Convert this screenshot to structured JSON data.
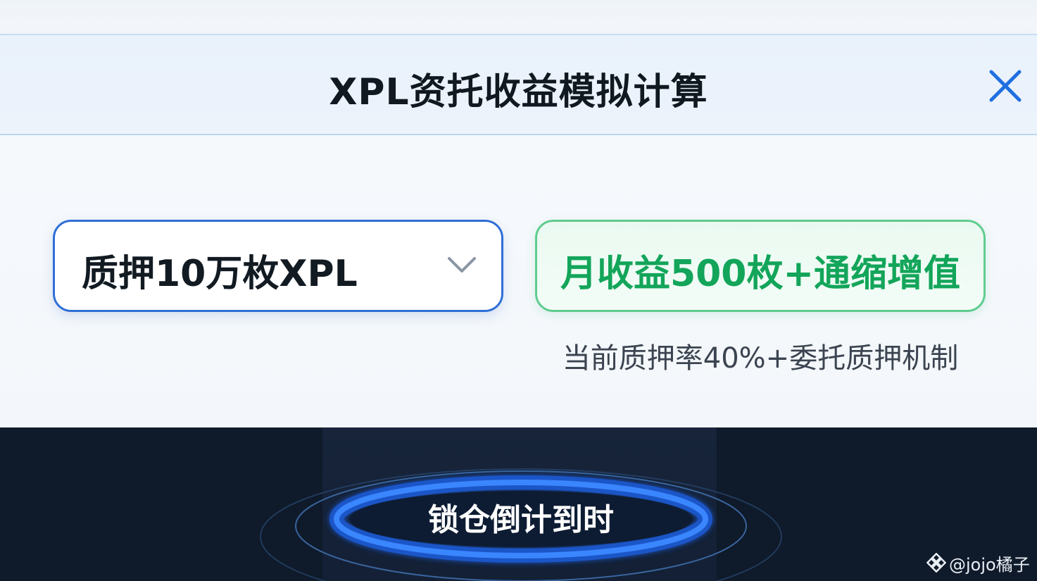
{
  "header": {
    "title": "XPL资托收益模拟计算",
    "close_icon": "close-icon"
  },
  "colors": {
    "accent_blue": "#2f6fd6",
    "result_green": "#13a55a",
    "result_border": "#5fcc8f",
    "dark_bg": "#0f1a2a",
    "ring_blue": "#2d7cff"
  },
  "stake_select": {
    "value": "质押10万枚XPL",
    "icon": "chevron-down-icon"
  },
  "result": {
    "text": "月收益500枚+通缩增值",
    "note": "当前质押率40%+委托质押机制"
  },
  "countdown": {
    "label": "锁仓倒计到时"
  },
  "watermark": {
    "icon": "binance-logo-icon",
    "text": "@jojo橘子"
  }
}
